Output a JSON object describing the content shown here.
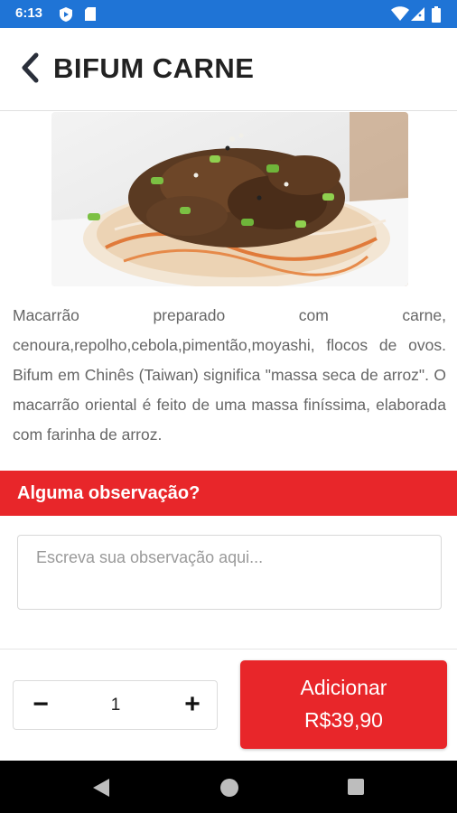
{
  "status_bar": {
    "time": "6:13",
    "icons": [
      "play-protect-icon",
      "sd-card-icon",
      "wifi-icon",
      "signal-icon",
      "battery-icon"
    ]
  },
  "header": {
    "back_icon": "chevron-left-icon",
    "title": "BIFUM CARNE"
  },
  "product": {
    "image_alt": "Bifum carne – macarrão de arroz com carne, cebolinha e gergelim",
    "description": "Macarrão preparado com carne, cenoura,repolho,cebola,pimentão,moyashi, flocos de ovos. Bifum em Chinês (Taiwan) significa \"massa seca de arroz\". O macarrão oriental é feito de uma massa finíssima, elaborada com farinha de arroz."
  },
  "observation": {
    "label": "Alguma observação?",
    "placeholder": "Escreva sua observação aqui...",
    "value": ""
  },
  "stepper": {
    "minus_label": "−",
    "quantity": "1",
    "plus_label": "+"
  },
  "add_button": {
    "label": "Adicionar",
    "price": "R$39,90"
  },
  "colors": {
    "status_bar": "#1f74d6",
    "accent": "#e8262a",
    "nav_bar": "#000000"
  }
}
